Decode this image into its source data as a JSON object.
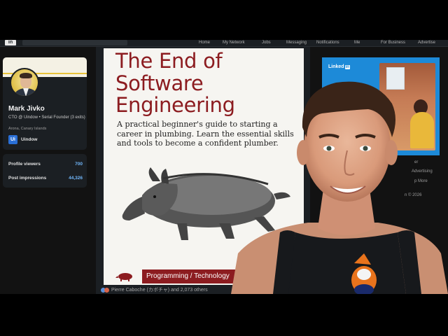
{
  "nav": {
    "logo": "in",
    "items": [
      "Home",
      "My Network",
      "Jobs",
      "Messaging",
      "Notifications",
      "Me",
      "For Business",
      "Advertise"
    ]
  },
  "profile": {
    "name": "Mark Jivko",
    "headline": "CTO @ Uindow • Serial Founder (3 exits)",
    "location": "Arona, Canary Islands",
    "company_logo": "Ui",
    "company": "Uindow"
  },
  "stats": [
    {
      "label": "Profile viewers",
      "value": "700"
    },
    {
      "label": "Post impressions",
      "value": "44,326"
    }
  ],
  "post": {
    "book_title_lines": [
      "The End of",
      "Software",
      "Engineering"
    ],
    "book_subtitle": "A practical beginner's guide to starting a career in plumbing. Learn the essential skills and tools to become a confident plumber.",
    "category": "Programming / Technology",
    "reactions": "Pierre Caboche (カボチャ) and 2,073 others"
  },
  "ad": {
    "brand": "Linked",
    "brand_in": "in"
  },
  "rail": {
    "line1": "er",
    "line2": "Advertising",
    "line3": "p   More",
    "copyright": "n © 2026"
  },
  "colors": {
    "book_accent": "#8c1c20",
    "link_blue": "#71b7fb",
    "card_bg": "#1b1f23"
  }
}
